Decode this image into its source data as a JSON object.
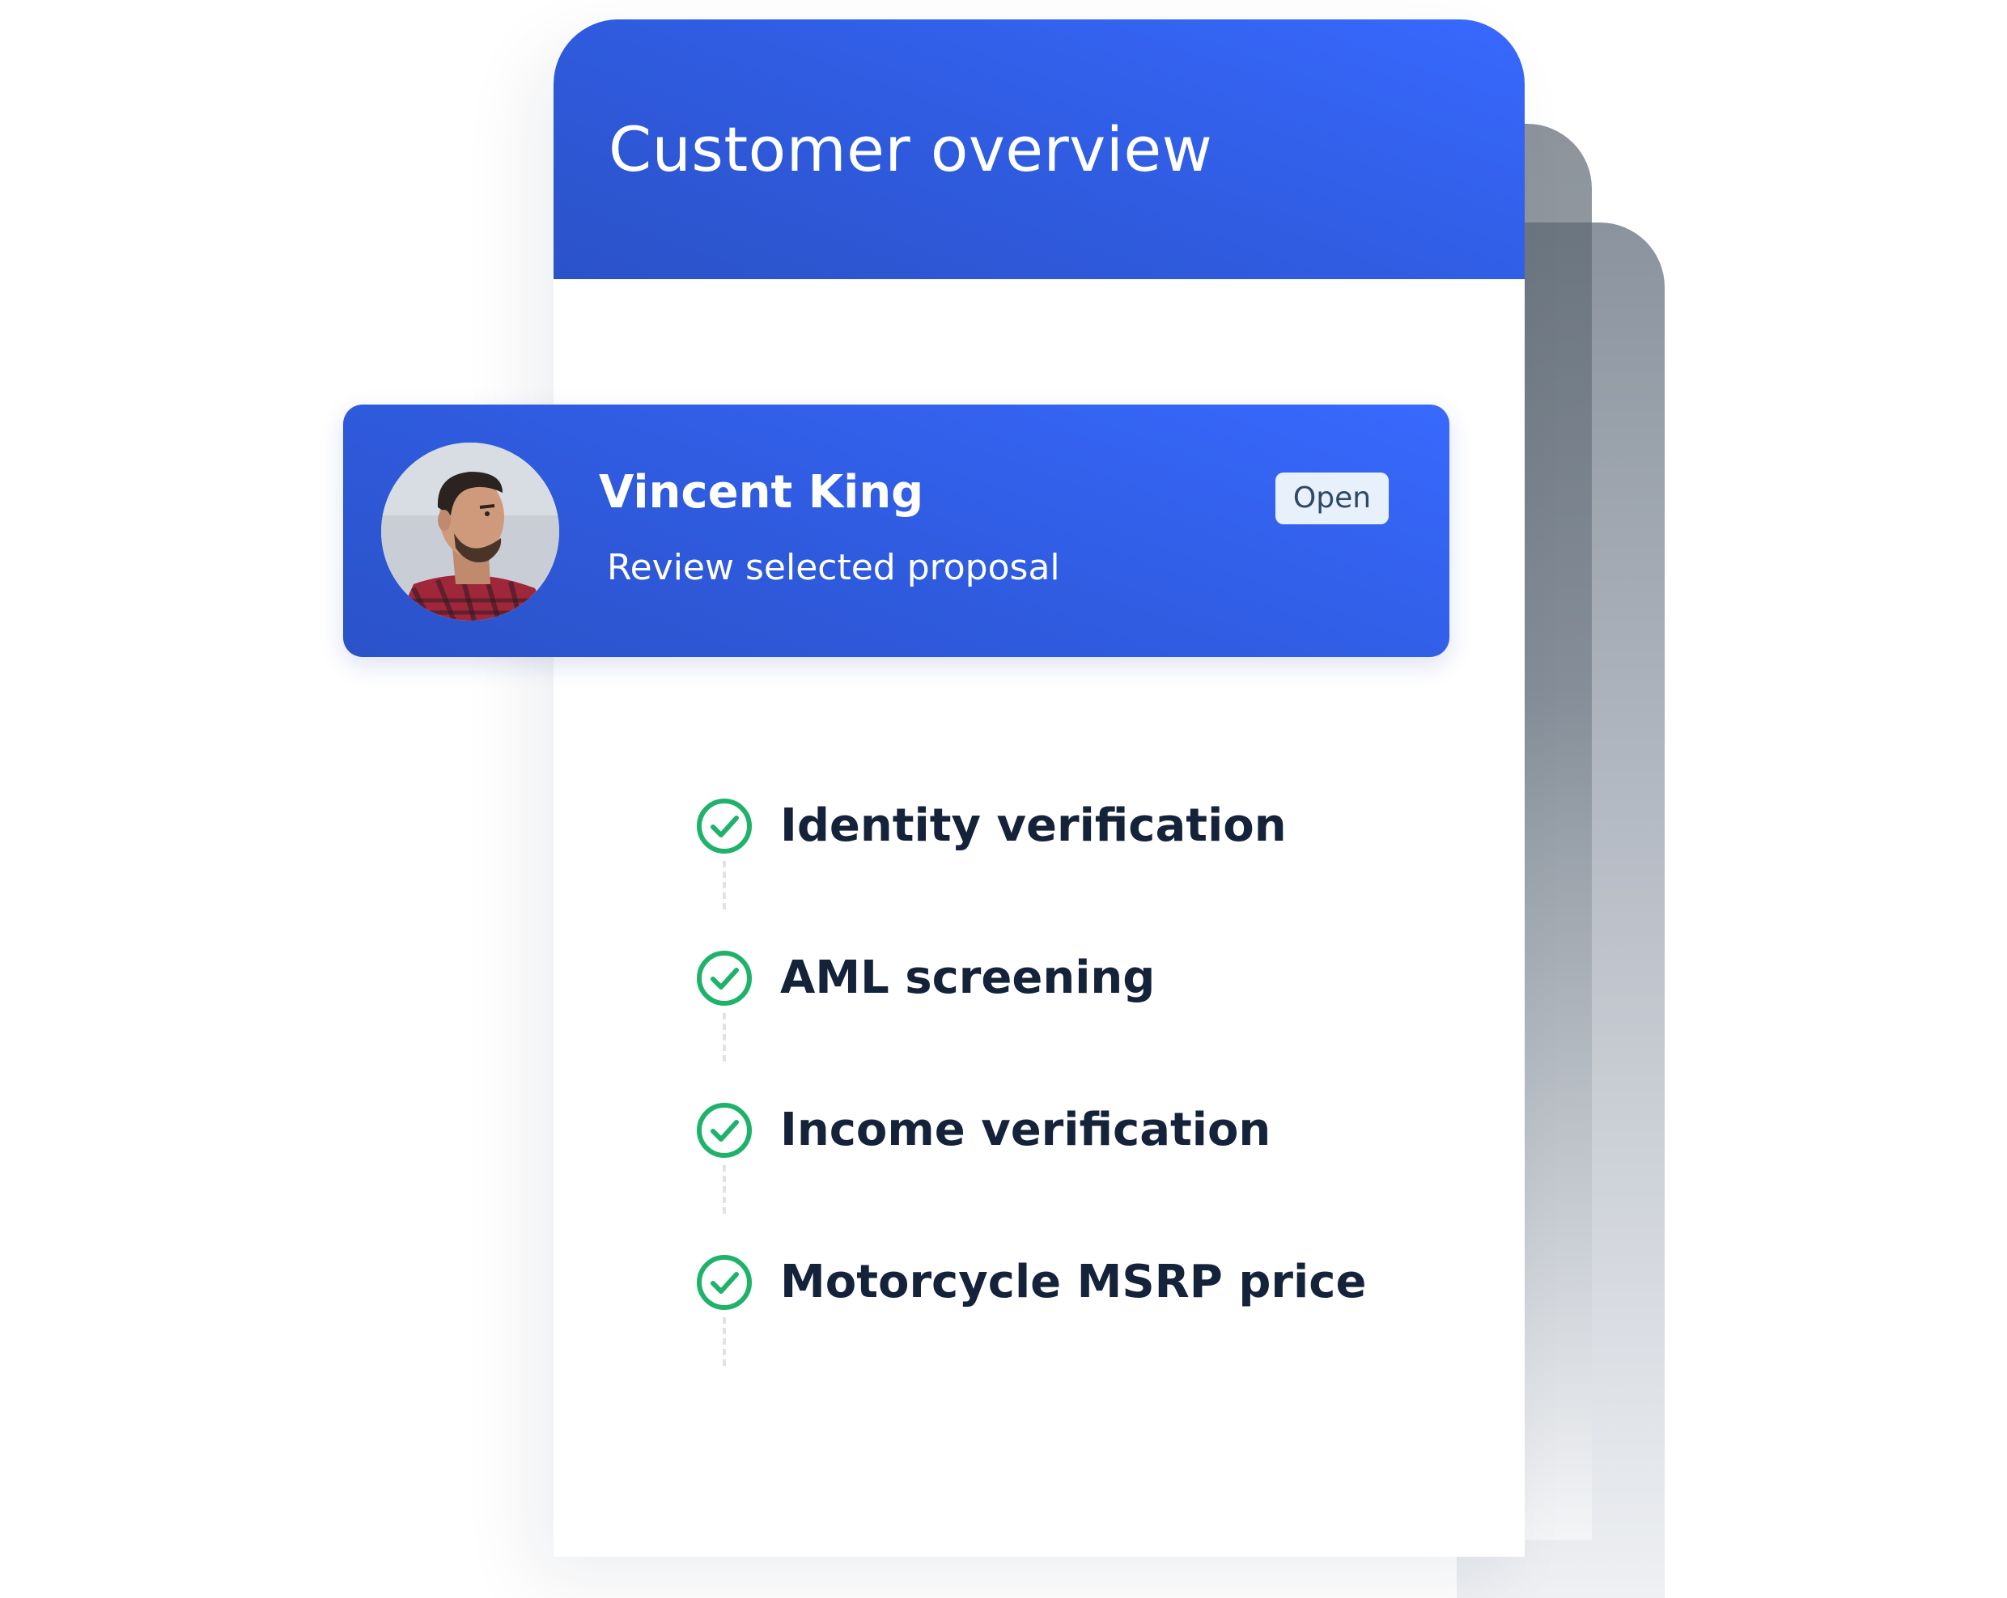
{
  "header": {
    "title": "Customer overview"
  },
  "customer": {
    "name": "Vincent King",
    "subtitle": "Review selected proposal",
    "status": "Open",
    "avatar_icon": "person-photo"
  },
  "checklist": {
    "items": [
      {
        "label": "Identity verification",
        "icon": "check-circle-icon",
        "checked": true
      },
      {
        "label": "AML screening",
        "icon": "check-circle-icon",
        "checked": true
      },
      {
        "label": "Income verification",
        "icon": "check-circle-icon",
        "checked": true
      },
      {
        "label": "Motorcycle MSRP price",
        "icon": "check-circle-icon",
        "checked": true
      }
    ]
  },
  "colors": {
    "primary_blue": "#3869fe",
    "primary_blue_dark": "#2b52c8",
    "check_green": "#1fb26b",
    "text_dark": "#14223a",
    "badge_bg": "#e8f0fb",
    "badge_text": "#2c4a66"
  }
}
